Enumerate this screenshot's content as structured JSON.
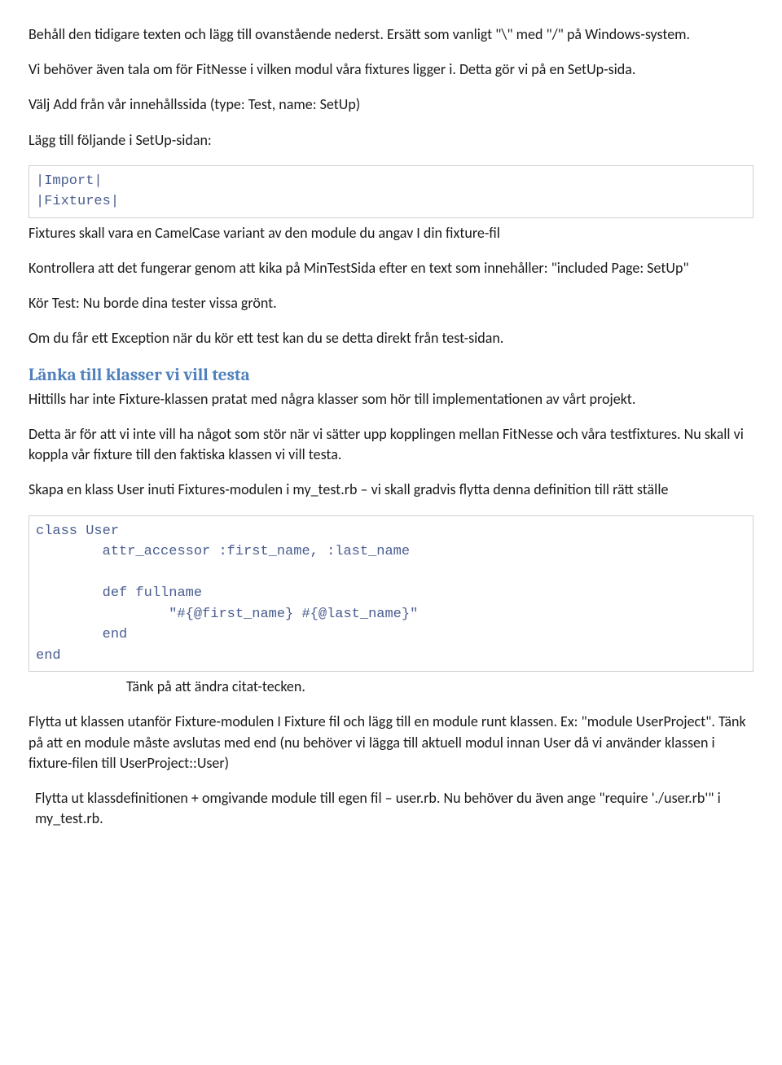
{
  "para1": "Behåll den tidigare texten och lägg till ovanstående nederst. Ersätt som vanligt \"\\\" med \"/\" på Windows-system.",
  "para2": "Vi behöver även tala om för FitNesse i vilken modul våra fixtures ligger i. Detta gör vi på en SetUp-sida.",
  "para3": "Välj Add från vår innehållssida (type: Test, name: SetUp)",
  "para4": "Lägg till följande i SetUp-sidan:",
  "code1": "|Import|\n|Fixtures|",
  "para5": "Fixtures skall vara en CamelCase variant av den module du angav I din fixture-fil",
  "para6": "Kontrollera att det fungerar genom att kika på MinTestSida efter en text som innehåller: \"included Page: SetUp\"",
  "para7": "Kör Test: Nu borde dina tester vissa grönt.",
  "para8": "Om du får ett Exception när du kör ett test kan du se detta direkt från test-sidan.",
  "heading1": "Länka till klasser vi vill testa",
  "para9": "Hittills har inte Fixture-klassen pratat med några klasser som hör till implementationen av vårt projekt.",
  "para10": "Detta är för att vi inte vill ha något som stör när vi sätter upp kopplingen mellan FitNesse och våra testfixtures. Nu skall vi koppla vår fixture till den faktiska klassen vi vill testa.",
  "para11": "Skapa en klass User inuti Fixtures-modulen i my_test.rb – vi skall gradvis flytta denna definition till rätt ställe",
  "code2": "class User\n        attr_accessor :first_name, :last_name\n\n        def fullname\n                \"#{@first_name} #{@last_name}\"\n        end\nend",
  "note1": "Tänk på att ändra citat-tecken.",
  "para12": "Flytta ut klassen utanför Fixture-modulen I Fixture fil och lägg till en module runt klassen. Ex: \"module UserProject\". Tänk på att en module måste avslutas med end (nu behöver vi lägga till aktuell modul innan User då vi använder klassen i fixture-filen till UserProject::User)",
  "para13": " Flytta ut klassdefinitionen + omgivande module till egen fil – user.rb. Nu behöver du även ange \"require './user.rb'\" i my_test.rb."
}
